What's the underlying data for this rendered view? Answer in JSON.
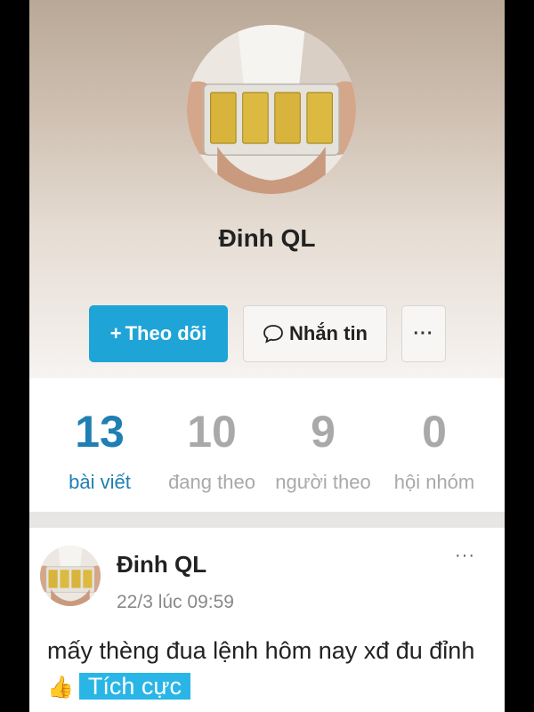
{
  "profile": {
    "name": "Đinh QL",
    "follow_label": "Theo dõi",
    "follow_prefix": "+",
    "message_label": "Nhắn tin",
    "more_label": "···"
  },
  "stats": [
    {
      "value": "13",
      "label": "bài viết"
    },
    {
      "value": "10",
      "label": "đang theo"
    },
    {
      "value": "9",
      "label": "người theo"
    },
    {
      "value": "0",
      "label": "hội nhóm"
    }
  ],
  "post": {
    "author": "Đinh QL",
    "time": "22/3 lúc 09:59",
    "more_label": "···",
    "text": "mấy thèng đua lệnh hôm nay xđ đu đỉnh",
    "emoji": "👍",
    "tag": "Tích cực"
  },
  "colors": {
    "accent": "#1fa4d8",
    "active_stat": "#1f7fb3",
    "inactive_stat": "#a9a9a9",
    "tag_bg": "#29b6e6"
  },
  "icons": {
    "message": "speech-bubble-icon",
    "more": "ellipsis-icon",
    "emoji": "thumbs-up-icon"
  }
}
